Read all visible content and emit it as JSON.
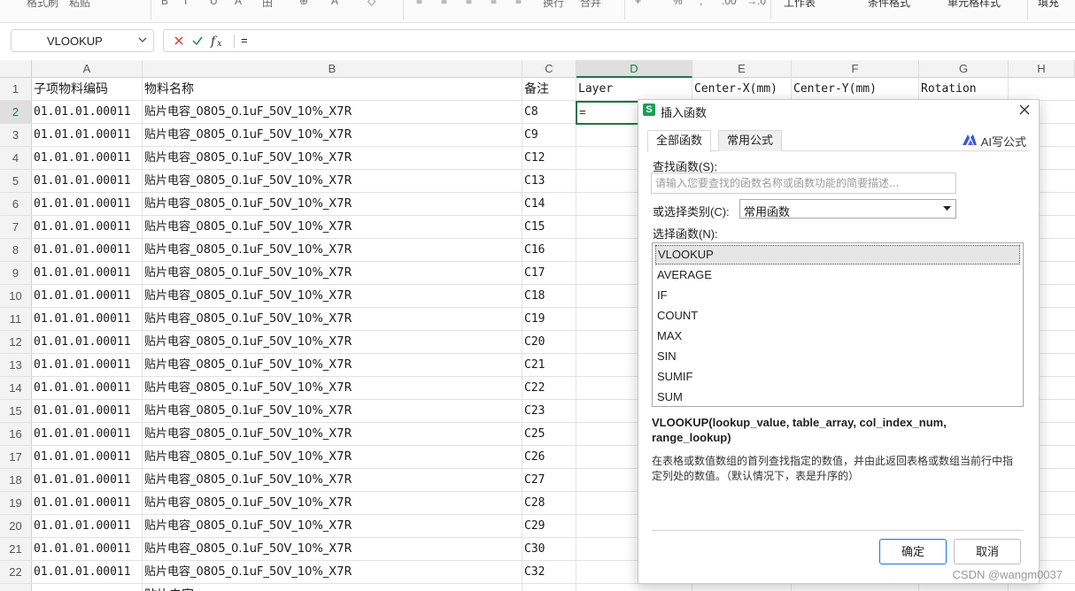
{
  "ribbon": {
    "items": [
      "格式刷",
      "粘贴",
      "B",
      "I",
      "U",
      "A",
      "田",
      "⊕",
      "A",
      "◇",
      "≡",
      "≡",
      "≡",
      "≡",
      "≡",
      "换行",
      "合并",
      "+",
      "%",
      ",",
      ".00",
      "→.0",
      "工作表",
      "条件格式",
      "单元格样式",
      "填充"
    ]
  },
  "formula_bar": {
    "name_box": "VLOOKUP",
    "formula": "="
  },
  "sheet": {
    "columns": [
      "A",
      "B",
      "C",
      "D",
      "E",
      "F",
      "G",
      "H"
    ],
    "active_column": "D",
    "active_row": "2",
    "header_row": {
      "label": "1",
      "cells": [
        "子项物料编码",
        "物料名称",
        "备注",
        "Layer",
        "Center-X(mm)",
        "Center-Y(mm)",
        "Rotation"
      ]
    },
    "rows": [
      {
        "n": "2",
        "code": "01.01.01.00011",
        "name": "贴片电容_0805_0.1uF_50V_10%_X7R",
        "note": "C8"
      },
      {
        "n": "3",
        "code": "01.01.01.00011",
        "name": "贴片电容_0805_0.1uF_50V_10%_X7R",
        "note": "C9"
      },
      {
        "n": "4",
        "code": "01.01.01.00011",
        "name": "贴片电容_0805_0.1uF_50V_10%_X7R",
        "note": "C12"
      },
      {
        "n": "5",
        "code": "01.01.01.00011",
        "name": "贴片电容_0805_0.1uF_50V_10%_X7R",
        "note": "C13"
      },
      {
        "n": "6",
        "code": "01.01.01.00011",
        "name": "贴片电容_0805_0.1uF_50V_10%_X7R",
        "note": "C14"
      },
      {
        "n": "7",
        "code": "01.01.01.00011",
        "name": "贴片电容_0805_0.1uF_50V_10%_X7R",
        "note": "C15"
      },
      {
        "n": "8",
        "code": "01.01.01.00011",
        "name": "贴片电容_0805_0.1uF_50V_10%_X7R",
        "note": "C16"
      },
      {
        "n": "9",
        "code": "01.01.01.00011",
        "name": "贴片电容_0805_0.1uF_50V_10%_X7R",
        "note": "C17"
      },
      {
        "n": "10",
        "code": "01.01.01.00011",
        "name": "贴片电容_0805_0.1uF_50V_10%_X7R",
        "note": "C18"
      },
      {
        "n": "11",
        "code": "01.01.01.00011",
        "name": "贴片电容_0805_0.1uF_50V_10%_X7R",
        "note": "C19"
      },
      {
        "n": "12",
        "code": "01.01.01.00011",
        "name": "贴片电容_0805_0.1uF_50V_10%_X7R",
        "note": "C20"
      },
      {
        "n": "13",
        "code": "01.01.01.00011",
        "name": "贴片电容_0805_0.1uF_50V_10%_X7R",
        "note": "C21"
      },
      {
        "n": "14",
        "code": "01.01.01.00011",
        "name": "贴片电容_0805_0.1uF_50V_10%_X7R",
        "note": "C22"
      },
      {
        "n": "15",
        "code": "01.01.01.00011",
        "name": "贴片电容_0805_0.1uF_50V_10%_X7R",
        "note": "C23"
      },
      {
        "n": "16",
        "code": "01.01.01.00011",
        "name": "贴片电容_0805_0.1uF_50V_10%_X7R",
        "note": "C25"
      },
      {
        "n": "17",
        "code": "01.01.01.00011",
        "name": "贴片电容_0805_0.1uF_50V_10%_X7R",
        "note": "C26"
      },
      {
        "n": "18",
        "code": "01.01.01.00011",
        "name": "贴片电容_0805_0.1uF_50V_10%_X7R",
        "note": "C27"
      },
      {
        "n": "19",
        "code": "01.01.01.00011",
        "name": "贴片电容_0805_0.1uF_50V_10%_X7R",
        "note": "C28"
      },
      {
        "n": "20",
        "code": "01.01.01.00011",
        "name": "贴片电容_0805_0.1uF_50V_10%_X7R",
        "note": "C29"
      },
      {
        "n": "21",
        "code": "01.01.01.00011",
        "name": "贴片电容_0805_0.1uF_50V_10%_X7R",
        "note": "C30"
      },
      {
        "n": "22",
        "code": "01.01.01.00011",
        "name": "贴片电容_0805_0.1uF_50V_10%_X7R",
        "note": "C32"
      }
    ],
    "partial_row_text": "贴片电容",
    "active_cell_value": "="
  },
  "dialog": {
    "title": "插入函数",
    "app_logo": "S",
    "tabs": [
      "全部函数",
      "常用公式"
    ],
    "active_tab": "全部函数",
    "ai_button": "AI写公式",
    "search_label": "查找函数(S):",
    "search_placeholder": "请输入您要查找的函数名称或函数功能的简要描述...",
    "category_label": "或选择类别(C):",
    "category_value": "常用函数",
    "function_list_label": "选择函数(N):",
    "functions": [
      "VLOOKUP",
      "AVERAGE",
      "IF",
      "COUNT",
      "MAX",
      "SIN",
      "SUMIF",
      "SUM"
    ],
    "selected_function": "VLOOKUP",
    "signature": "VLOOKUP(lookup_value, table_array, col_index_num, range_lookup)",
    "description": "在表格或数值数组的首列查找指定的数值，并由此返回表格或数组当前行中指定列处的数值。（默认情况下，表是升序的）",
    "ok_label": "确定",
    "cancel_label": "取消"
  },
  "watermark": "CSDN @wangm0037",
  "colors": {
    "accent_green": "#217346",
    "primary_blue": "#1a73e8",
    "logo_green": "#18a058"
  }
}
